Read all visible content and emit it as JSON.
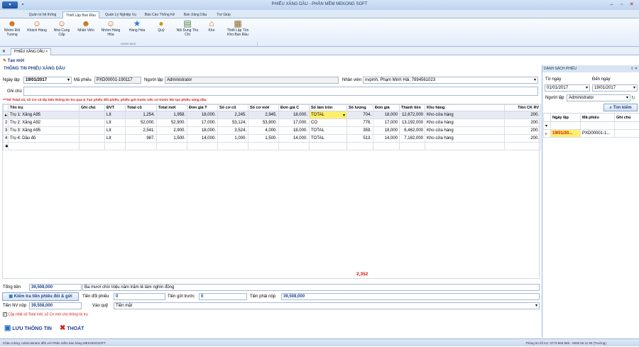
{
  "window": {
    "title": "PHIẾU XĂNG DẦU - PHẦN MỀM MEKONG SOFT"
  },
  "ribbon": {
    "tabs": [
      "Quản trị hệ thống",
      "Thiết Lập Ban Đầu",
      "Quản Lý Nghiệp Vụ",
      "Báo Cáo Thống Kê",
      "Bán Xăng Dầu",
      "Trợ Giúp"
    ],
    "buttons": [
      {
        "label": "Nhóm Đối Tượng",
        "icon": "group-icon"
      },
      {
        "label": "Khách Hàng",
        "icon": "customer-icon"
      },
      {
        "label": "Nhà Cung Cấp",
        "icon": "supplier-icon"
      },
      {
        "label": "Nhân Viên",
        "icon": "employee-icon"
      },
      {
        "label": "Nhóm Hàng Hóa",
        "icon": "product-group-icon"
      },
      {
        "label": "Hàng Hóa",
        "icon": "star-icon"
      },
      {
        "label": "Quỹ",
        "icon": "coins-icon"
      },
      {
        "label": "Nội Dung Thu Chi",
        "icon": "document-arrow-icon"
      },
      {
        "label": "Kho",
        "icon": "warehouse-icon"
      },
      {
        "label": "Thiết Lập Tồn Kho Ban Đầu",
        "icon": "inventory-icon"
      }
    ],
    "group_label": "DANH MỤC"
  },
  "doc_tab": {
    "label": "PHIẾU XĂNG DẦU"
  },
  "toolbar": {
    "new_label": "Tạo mới"
  },
  "form": {
    "section_title": "THÔNG TIN PHIẾU XĂNG DẦU",
    "date_label": "Ngày lập",
    "date_value": "19/01/2017",
    "code_label": "Mã phiếu",
    "code_value": "PXD00001-190117",
    "creator_label": "Người lập",
    "creator_value": "Administrator",
    "employee_label": "Nhân viên",
    "employee_value": "nvpmh, Phạm Minh Hải, 7894561023",
    "note_label": "Ghi chú",
    "note_value": "",
    "warning": "***Số Total cũ, số Cơ cũ lấy bên thông tin trụ qua & Tạo phiếu đổi phiếu, phiếu gửi trước nếu có trước khi tạo phiếu xăng dầu"
  },
  "grid": {
    "columns": [
      "Tên trụ",
      "Ghi chú",
      "ĐVT",
      "Total cũ",
      "Total mới",
      "Đơn giá T",
      "Số cơ cũ",
      "Số cơ mới",
      "Đơn giá C",
      "Số làm tròn",
      "Số lượng",
      "Đơn giá",
      "Thành tiền",
      "Kho hàng",
      "Tiền CK RV"
    ],
    "rows": [
      {
        "no": "1",
        "name": "Trụ 1: Xăng A95",
        "note": "",
        "unit": "Lít",
        "total_old": "1,254.",
        "total_new": "1,958.",
        "price_t": "18,000.",
        "co_old": "2,245.",
        "co_new": "2,945.",
        "price_c": "18,000.",
        "round": "TOTAL",
        "qty": "704.",
        "price": "18,000",
        "amount": "12,672,000",
        "store": "Kho cửa hàng",
        "ck": "200."
      },
      {
        "no": "2",
        "name": "Trụ 2: Xăng A92",
        "note": "",
        "unit": "Lít",
        "total_old": "52,000.",
        "total_new": "52,900.",
        "price_t": "17,000.",
        "co_old": "53,124.",
        "co_new": "53,900.",
        "price_c": "17,000.",
        "round": "CO",
        "qty": "776.",
        "price": "17,000",
        "amount": "13,192,000",
        "store": "Kho cửa hàng",
        "ck": "200."
      },
      {
        "no": "3",
        "name": "Trụ 3: Xăng A95",
        "note": "",
        "unit": "Lít",
        "total_old": "2,541.",
        "total_new": "2,900.",
        "price_t": "18,000.",
        "co_old": "3,524.",
        "co_new": "4,000.",
        "price_c": "18,000.",
        "round": "TOTAL",
        "qty": "359.",
        "price": "18,000",
        "amount": "6,462,000",
        "store": "Kho cửa hàng",
        "ck": "200."
      },
      {
        "no": "4",
        "name": "Trụ 4: Dầu đỏ",
        "note": "",
        "unit": "Lít",
        "total_old": "987.",
        "total_new": "1,500.",
        "price_t": "14,000.",
        "co_old": "1,000.",
        "co_new": "1,500.",
        "price_c": "14,000.",
        "round": "TOTAL",
        "qty": "513.",
        "price": "14,000",
        "amount": "7,182,000",
        "store": "Kho cửa hàng",
        "ck": "200."
      }
    ],
    "qty_total": "2,352"
  },
  "summary": {
    "total_label": "Tổng tiền",
    "total_value": "39,508,000",
    "total_words": "Ba mươi chín triệu năm trăm lẻ tám nghìn đồng",
    "check_button": "Kiểm tra tiền phiếu đổi & gửi",
    "exchange_label": "Tiền đổi phiếu",
    "exchange_value": "0",
    "advance_label": "Tiền gửi trước",
    "advance_value": "0",
    "payable_label": "Tiền phải nộp",
    "payable_value": "39,508,000",
    "paid_label": "Tiền NV nộp",
    "paid_value": "39,508,000",
    "fund_label": "Vào quỹ",
    "fund_value": "Tiền mặt",
    "update_checkbox_label": "Cập nhật số Total mới, số Cơ mới cho thông tin trụ"
  },
  "actions": {
    "save_label": "LƯU THÔNG TIN",
    "exit_label": "THOÁT"
  },
  "side": {
    "title": "DANH SÁCH PHIẾU",
    "from_label": "Từ ngày",
    "from_value": "01/01/2017",
    "to_label": "Đến ngày",
    "to_value": "19/01/2017",
    "creator_label": "Người lập",
    "creator_value": "Administrator",
    "search_label": "Tìm kiếm",
    "columns": [
      "Ngày lập",
      "Mã phiếu",
      "Ghi chú"
    ],
    "rows": [
      {
        "date": "19/01/20...",
        "code": "PXD00001-1...",
        "note": ""
      }
    ]
  },
  "status": {
    "left": "Chào mừng: Administrator đến với Phần mềm bán hàng MEKONGSOFT",
    "right": "Thông tin hỗ trợ: 0773 868 968 - 0939 55 11 90 (Trường)"
  },
  "colors": {
    "accent": "#1c3f8f",
    "warning": "#d01010",
    "highlight": "#ffee6e"
  }
}
